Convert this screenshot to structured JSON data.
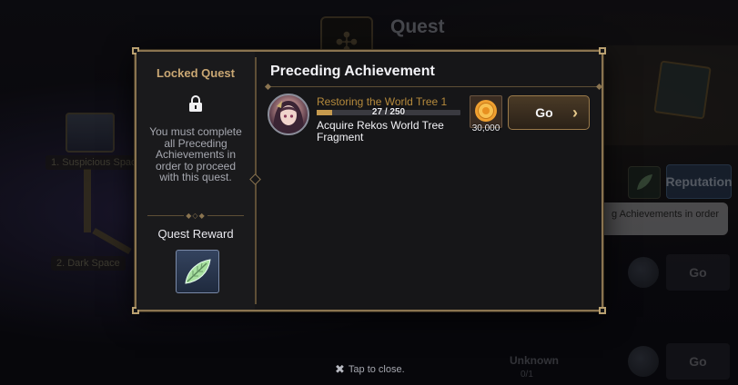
{
  "background": {
    "quest_title": "Quest",
    "node_1_label": "1. Suspicious Spac",
    "node_2_label": "2. Dark Space",
    "node_3_label": "",
    "reputation_label": "Reputation",
    "banner_text": "g Achievements in order",
    "go_label_1": "Go",
    "go_label_2": "Go",
    "unknown_label": "Unknown",
    "unknown_count": "0/1"
  },
  "modal": {
    "locked_title": "Locked Quest",
    "locked_message": "You must complete all Preceding Achievements in order to proceed with this quest.",
    "reward_title": "Quest Reward",
    "section_title": "Preceding Achievement",
    "achievement": {
      "subtitle": "Restoring the World Tree 1",
      "progress_text": "27 / 250",
      "progress_fraction": 0.108,
      "description": "Acquire Rekos World Tree Fragment",
      "reward_amount": "30,000",
      "go_label": "Go"
    }
  },
  "footer": {
    "tap_close": "Tap to close."
  },
  "colors": {
    "accent_gold": "#c69a4e",
    "frame": "#8a7450",
    "locked_title": "#c9a773",
    "subtitle": "#b58a3c"
  },
  "icons": [
    "lock-icon",
    "leaf-icon",
    "coin-icon",
    "chevron-right-icon",
    "close-icon",
    "quest-compass-icon"
  ]
}
